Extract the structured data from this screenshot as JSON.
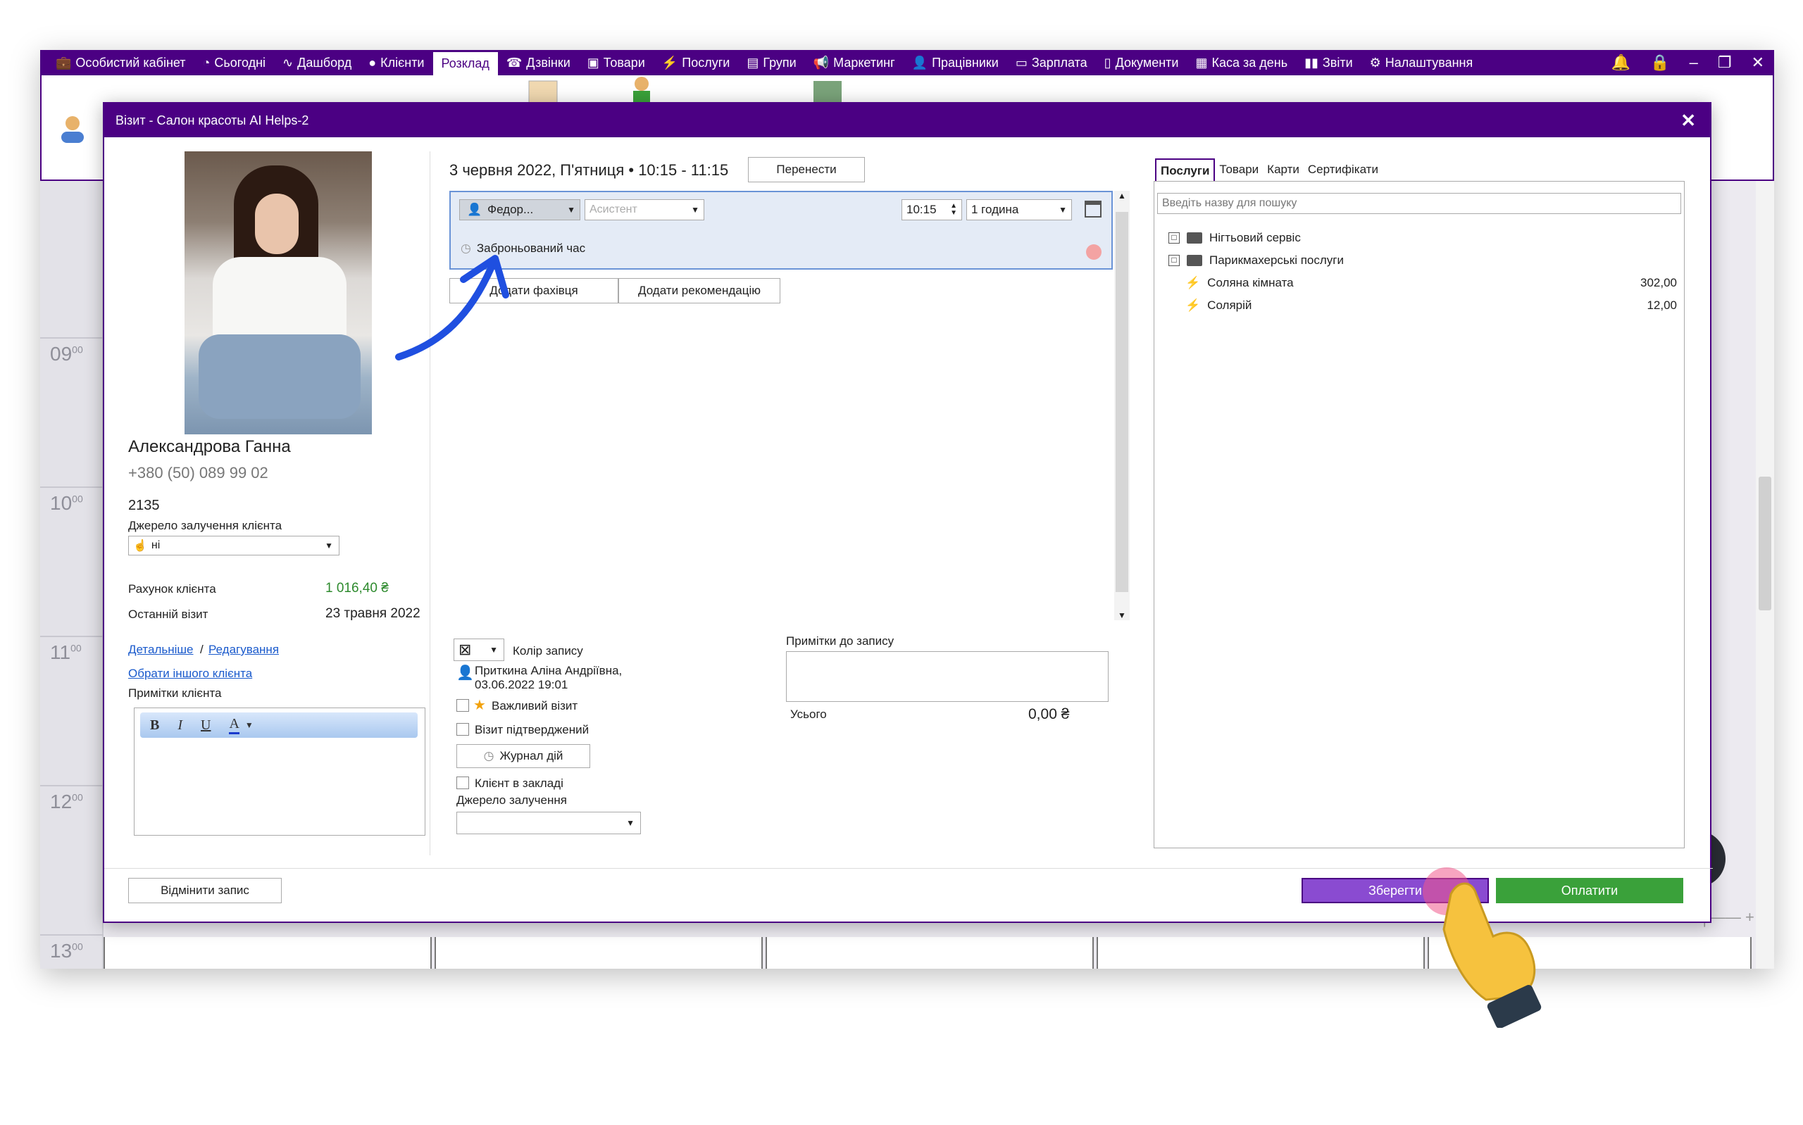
{
  "nav": {
    "items": [
      {
        "label": "Особистий кабінет",
        "icon": "briefcase-icon"
      },
      {
        "label": "Сьогодні",
        "icon": "clock-icon"
      },
      {
        "label": "Дашборд",
        "icon": "pulse-icon"
      },
      {
        "label": "Клієнти",
        "icon": "user-circle-icon"
      },
      {
        "label": "Розклад",
        "icon": "",
        "active": true
      },
      {
        "label": "Дзвінки",
        "icon": "phone-icon"
      },
      {
        "label": "Товари",
        "icon": "box-icon"
      },
      {
        "label": "Послуги",
        "icon": "lightning-icon"
      },
      {
        "label": "Групи",
        "icon": "group-icon"
      },
      {
        "label": "Маркетинг",
        "icon": "megaphone-icon"
      },
      {
        "label": "Працівники",
        "icon": "person-icon"
      },
      {
        "label": "Зарплата",
        "icon": "money-icon"
      },
      {
        "label": "Документи",
        "icon": "document-icon"
      },
      {
        "label": "Каса за день",
        "icon": "calculator-icon"
      },
      {
        "label": "Звіти",
        "icon": "bar-chart-icon"
      },
      {
        "label": "Налаштування",
        "icon": "gear-icon"
      }
    ]
  },
  "schedule": {
    "hours": [
      {
        "h": "09",
        "m": "00"
      },
      {
        "h": "10",
        "m": "00"
      },
      {
        "h": "11",
        "m": "00"
      },
      {
        "h": "12",
        "m": "00"
      },
      {
        "h": "13",
        "m": "00"
      }
    ]
  },
  "dialog": {
    "title": "Візит - Салон красоты AI Helps-2",
    "client": {
      "name": "Александрова Ганна",
      "phone": "+380 (50) 089 99 02",
      "id": "2135",
      "source_label": "Джерело залучення клієнта",
      "source_value": "ні",
      "account_label": "Рахунок клієнта",
      "account_value": "1 016,40 ₴",
      "last_visit_label": "Останній візит",
      "last_visit_value": "23 травня 2022",
      "details_link": "Детальніше",
      "edit_link": "Редагування",
      "choose_other_link": "Обрати іншого клієнта",
      "notes_label": "Примітки клієнта"
    },
    "appointment": {
      "datetime": "3 червня 2022, П'ятниця • 10:15 - 11:15",
      "move_button": "Перенести",
      "specialist": "Федор...",
      "assistant_placeholder": "Асистент",
      "time": "10:15",
      "duration": "1 година",
      "booked_label": "Заброньований час",
      "add_specialist_button": "Додати фахівця",
      "add_recommendation_button": "Додати рекомендацію"
    },
    "options": {
      "color_label": "Колір запису",
      "creator": "Приткина Аліна Андріївна,",
      "created_at": "03.06.2022 19:01",
      "important_label": "Важливий візит",
      "confirmed_label": "Візит підтверджений",
      "journal_button": "Журнал дій",
      "in_salon_label": "Клієнт в закладі",
      "source_label": "Джерело залучення"
    },
    "notes": {
      "label": "Примітки до запису",
      "total_label": "Усього",
      "total_value": "0,00 ₴"
    },
    "services": {
      "tabs": [
        "Послуги",
        "Товари",
        "Карти",
        "Сертифікати"
      ],
      "search_placeholder": "Введіть назву для пошуку",
      "tree": [
        {
          "type": "folder",
          "label": "Нігтьовий сервіс"
        },
        {
          "type": "folder",
          "label": "Парикмахерські послуги"
        },
        {
          "type": "service",
          "label": "Соляна кімната",
          "price": "302,00"
        },
        {
          "type": "service",
          "label": "Солярій",
          "price": "12,00"
        }
      ]
    },
    "footer": {
      "cancel_button": "Відмінити запис",
      "save_button": "Зберегти",
      "pay_button": "Оплатити"
    }
  },
  "colors": {
    "accent": "#4b0083",
    "save": "#8a4bd1",
    "pay": "#3aa13a",
    "balance": "#2d8a2d"
  }
}
